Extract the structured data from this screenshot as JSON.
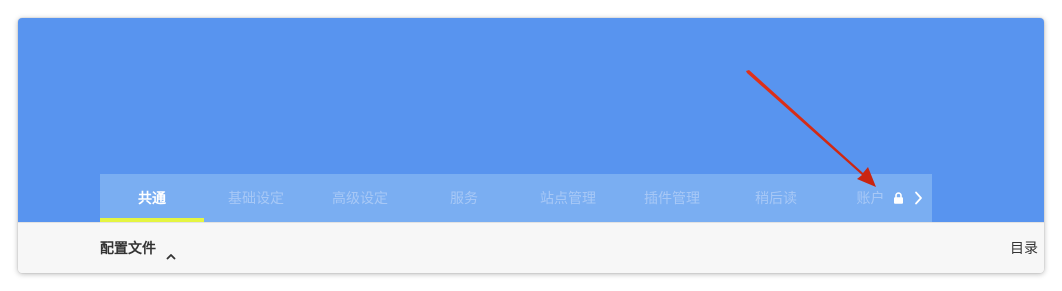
{
  "colors": {
    "hero_background": "#5894ef",
    "tabbar_background": "#7aaef2",
    "active_indicator": "#e5f542",
    "annotation_arrow": "#d42c12"
  },
  "tabs": [
    {
      "label": "共通",
      "active": true
    },
    {
      "label": "基础设定",
      "active": false
    },
    {
      "label": "高级设定",
      "active": false
    },
    {
      "label": "服务",
      "active": false
    },
    {
      "label": "站点管理",
      "active": false
    },
    {
      "label": "插件管理",
      "active": false
    },
    {
      "label": "稍后读",
      "active": false
    },
    {
      "label": "账户",
      "active": false,
      "icon": "lock-icon"
    }
  ],
  "tabbar": {
    "next_icon": "chevron-right-icon"
  },
  "toolbar": {
    "profile_label": "配置文件",
    "profile_icon": "chevron-up-icon",
    "toc_label": "目录"
  },
  "annotation": {
    "icon": "red-arrow-annotation"
  }
}
